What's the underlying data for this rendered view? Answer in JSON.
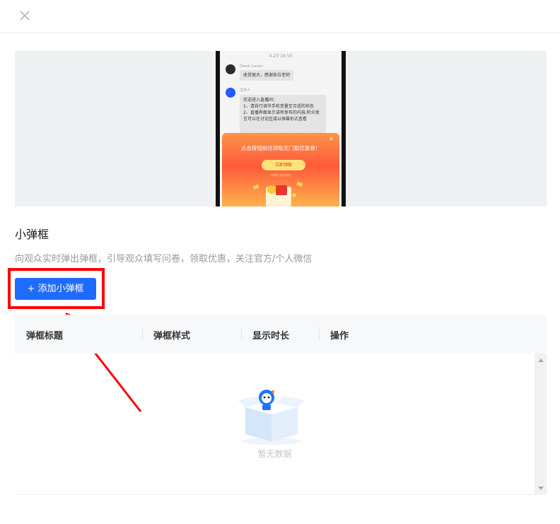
{
  "preview": {
    "timestamp": "4-23 18:50",
    "msg1_name": "Derek Larson",
    "msg1_text": "收货很大，感谢各位老师",
    "msg2_name": "主持人",
    "msg2_lines": [
      "欢迎进入直播间：",
      "1、请自行调节手机音量至合适的状态",
      "2、直播界面显示讲师发布的内容,听众发言可以在讨论区或以弹幕形式查看"
    ],
    "popup_title": "点击按钮前往领取无门槛优惠券！",
    "popup_button": "立即领取",
    "popup_sub": "10秒后自动关闭"
  },
  "section": {
    "title": "小弹框",
    "description": "向观众实时弹出弹框，引导观众填写问卷，领取优惠，关注官方/个人微信"
  },
  "add_button_label": "+ 添加小弹框",
  "table": {
    "columns": [
      "弹框标题",
      "弹框样式",
      "显示时长",
      "操作"
    ],
    "empty_text": "暂无数据"
  },
  "icons": {
    "close": "close-icon",
    "empty": "empty-box-icon"
  },
  "colors": {
    "primary": "#1e6cff",
    "highlight": "#ff0000"
  }
}
